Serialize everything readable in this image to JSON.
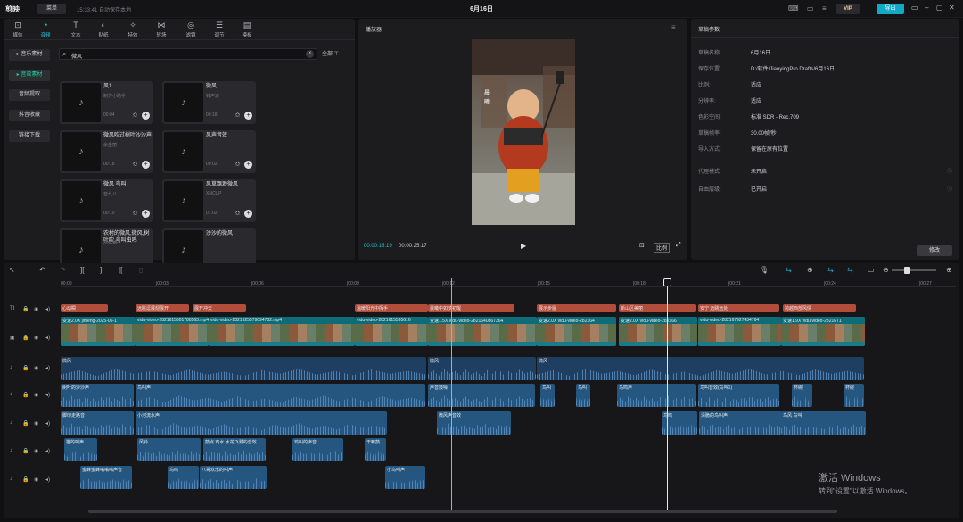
{
  "app": {
    "logo": "剪映",
    "menu_label": "菜单",
    "autosave": "15:33:41 自动保存本地",
    "doc_title": "6月16日",
    "vip": "VIP",
    "export": "导出"
  },
  "tools": [
    {
      "label": "媒体",
      "icon": "media-icon"
    },
    {
      "label": "音频",
      "icon": "audio-icon"
    },
    {
      "label": "文本",
      "icon": "text-icon"
    },
    {
      "label": "贴纸",
      "icon": "sticker-icon"
    },
    {
      "label": "特效",
      "icon": "effects-icon"
    },
    {
      "label": "转场",
      "icon": "transition-icon"
    },
    {
      "label": "滤镜",
      "icon": "filter-icon"
    },
    {
      "label": "调节",
      "icon": "adjust-icon"
    },
    {
      "label": "模板",
      "icon": "template-icon"
    }
  ],
  "subnav": [
    "▸ 音乐素材",
    "▸ 音效素材",
    "音频提取",
    "抖音收藏",
    "链接下载"
  ],
  "search": {
    "query": "微风",
    "filter_label": "全部"
  },
  "cards": [
    {
      "title": "风1",
      "author": "制作小助手",
      "duration": "00:04"
    },
    {
      "title": "微风",
      "author": "铃声达",
      "duration": "00:18"
    },
    {
      "title": "微风吹过树叶沙沙声",
      "author": "余金丽",
      "duration": "00:18"
    },
    {
      "title": "风声音效",
      "author": "",
      "duration": "00:02"
    },
    {
      "title": "微风 鸟叫",
      "author": "音九八",
      "duration": "00:10"
    },
    {
      "title": "风草飘渺微风",
      "author": "XNCUP",
      "duration": "01:02"
    },
    {
      "title": "农村的微风,微风,树叶吹,鸟叫虫鸣",
      "author": "XNCUP",
      "duration": ""
    },
    {
      "title": "沙沙的微风",
      "author": "",
      "duration": ""
    }
  ],
  "player": {
    "title": "播放器",
    "current": "00:00:15:19",
    "total": "00:00:25:17",
    "ratio": "比例"
  },
  "props": {
    "title": "草稿参数",
    "rows": [
      {
        "k": "草稿名称:",
        "v": "6月16日"
      },
      {
        "k": "保存位置:",
        "v": "D:/软件/JianyingPro Drafts/6月16日"
      },
      {
        "k": "比例:",
        "v": "适应"
      },
      {
        "k": "分辨率:",
        "v": "适应"
      },
      {
        "k": "色彩空间:",
        "v": "标准 SDR - Rec.709"
      },
      {
        "k": "草稿帧率:",
        "v": "30.00帧/秒"
      },
      {
        "k": "导入方式:",
        "v": "保留在原有位置"
      },
      {
        "k": "代理模式:",
        "v": "未开启"
      },
      {
        "k": "自由层级:",
        "v": "已开启"
      }
    ],
    "modify": "修改"
  },
  "ruler": [
    "00:00",
    "|00:03",
    "|00:06",
    "|00:09",
    "|00:12",
    "|00:15",
    "|00:18",
    "|00:21",
    "|00:24",
    "|00:27"
  ],
  "text_clips": [
    "心动瞬",
    "远眺逗展翅展开",
    "展开冲天",
    "温暖阳光中挥手",
    "晨曦中如梦初醒",
    "展示步履",
    "新山区美丽",
    "安宁 远眺远处",
    "跨越西部风情"
  ],
  "video_clips": [
    "变速2.0X jimeng-2025-06-1",
    "vidu-video-2821615301788563.mp4  00:00:04:03",
    "vidu-video-2821625579094782.mp4",
    "vidu-video-2821615595616",
    "变速1.5X vidu-video-2821640867364",
    "变速2.0X vidu-video-282164",
    "变速2.0X vidu-video-282166",
    "vidu-video-282167927434764",
    "变速1.9X vidu-video-2821671"
  ],
  "audio_tracks": [
    [
      "微风",
      "微风",
      "微风"
    ],
    [
      "树叶的沙沙声",
      "鸟叫声",
      "声音鼓噪",
      "鸟叫",
      "鸟叫",
      "鸟鸣声",
      "鸟叫音效(鸟叫1)",
      "杯碗",
      "杯碗"
    ],
    [
      "脚印走路音",
      "小河流水声",
      "微风声音效",
      "鸟鸣",
      "清脆的鸟叫声",
      "鸟风 鸟叫"
    ],
    [
      "猫的叫声",
      "风铃",
      "鼓点 鸡水 水花飞溅的音效",
      "鸡叫的声音",
      "干嘛鼓"
    ],
    [
      "蜜蜂蜜蜂嗡嗡嗡声音",
      "鸟鸣",
      "八哥欢乐的叫声",
      "小鸟叫声"
    ]
  ],
  "watermark": {
    "line1": "激活 Windows",
    "line2": "转到\"设置\"以激活 Windows。"
  }
}
